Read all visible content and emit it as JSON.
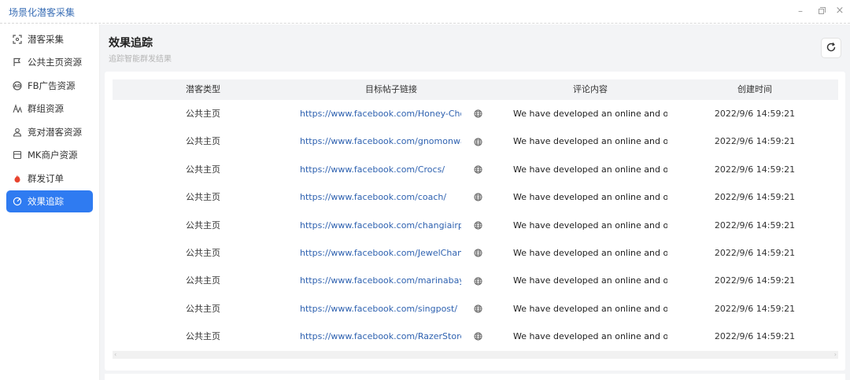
{
  "window": {
    "title": "场景化潜客采集",
    "controls": [
      "minimize-icon",
      "maximize-icon",
      "close-icon"
    ]
  },
  "sidebar": {
    "items": [
      {
        "label": "潜客采集",
        "icon": "scan-icon",
        "active": false
      },
      {
        "label": "公共主页资源",
        "icon": "flag-icon",
        "active": false
      },
      {
        "label": "FB广告资源",
        "icon": "ad-icon",
        "active": false
      },
      {
        "label": "群组资源",
        "icon": "group-icon",
        "active": false
      },
      {
        "label": "竞对潜客资源",
        "icon": "user-icon",
        "active": false
      },
      {
        "label": "MK商户资源",
        "icon": "store-icon",
        "active": false
      },
      {
        "label": "群发订单",
        "icon": "flame-icon",
        "active": false
      },
      {
        "label": "效果追踪",
        "icon": "track-icon",
        "active": true
      }
    ]
  },
  "page": {
    "title": "效果追踪",
    "subtitle": "追踪智能群发结果"
  },
  "table": {
    "columns": [
      "潜客类型",
      "目标帖子链接",
      "评论内容",
      "创建时间"
    ],
    "rows": [
      {
        "type": "公共主页",
        "link": "https://www.facebook.com/Honey-Choo-",
        "comment": "We have developed an online and offlir",
        "time": "2022/9/6 14:59:21"
      },
      {
        "type": "公共主页",
        "link": "https://www.facebook.com/gnomonwatcl",
        "comment": "We have developed an online and offlir",
        "time": "2022/9/6 14:59:21"
      },
      {
        "type": "公共主页",
        "link": "https://www.facebook.com/Crocs/",
        "comment": "We have developed an online and offlir",
        "time": "2022/9/6 14:59:21"
      },
      {
        "type": "公共主页",
        "link": "https://www.facebook.com/coach/",
        "comment": "We have developed an online and offlir",
        "time": "2022/9/6 14:59:21"
      },
      {
        "type": "公共主页",
        "link": "https://www.facebook.com/changiairport",
        "comment": "We have developed an online and offlir",
        "time": "2022/9/6 14:59:21"
      },
      {
        "type": "公共主页",
        "link": "https://www.facebook.com/JewelChangiA",
        "comment": "We have developed an online and offlir",
        "time": "2022/9/6 14:59:21"
      },
      {
        "type": "公共主页",
        "link": "https://www.facebook.com/marinabaysar",
        "comment": "We have developed an online and offlir",
        "time": "2022/9/6 14:59:21"
      },
      {
        "type": "公共主页",
        "link": "https://www.facebook.com/singpost/",
        "comment": "We have developed an online and offlir",
        "time": "2022/9/6 14:59:21"
      },
      {
        "type": "公共主页",
        "link": "https://www.facebook.com/RazerStoreSG",
        "comment": "We have developed an online and offlir",
        "time": "2022/9/6 14:59:21"
      }
    ]
  },
  "colors": {
    "accent": "#2f7bf1",
    "link": "#2f62b0",
    "title_bar_text": "#3b6fb6"
  }
}
